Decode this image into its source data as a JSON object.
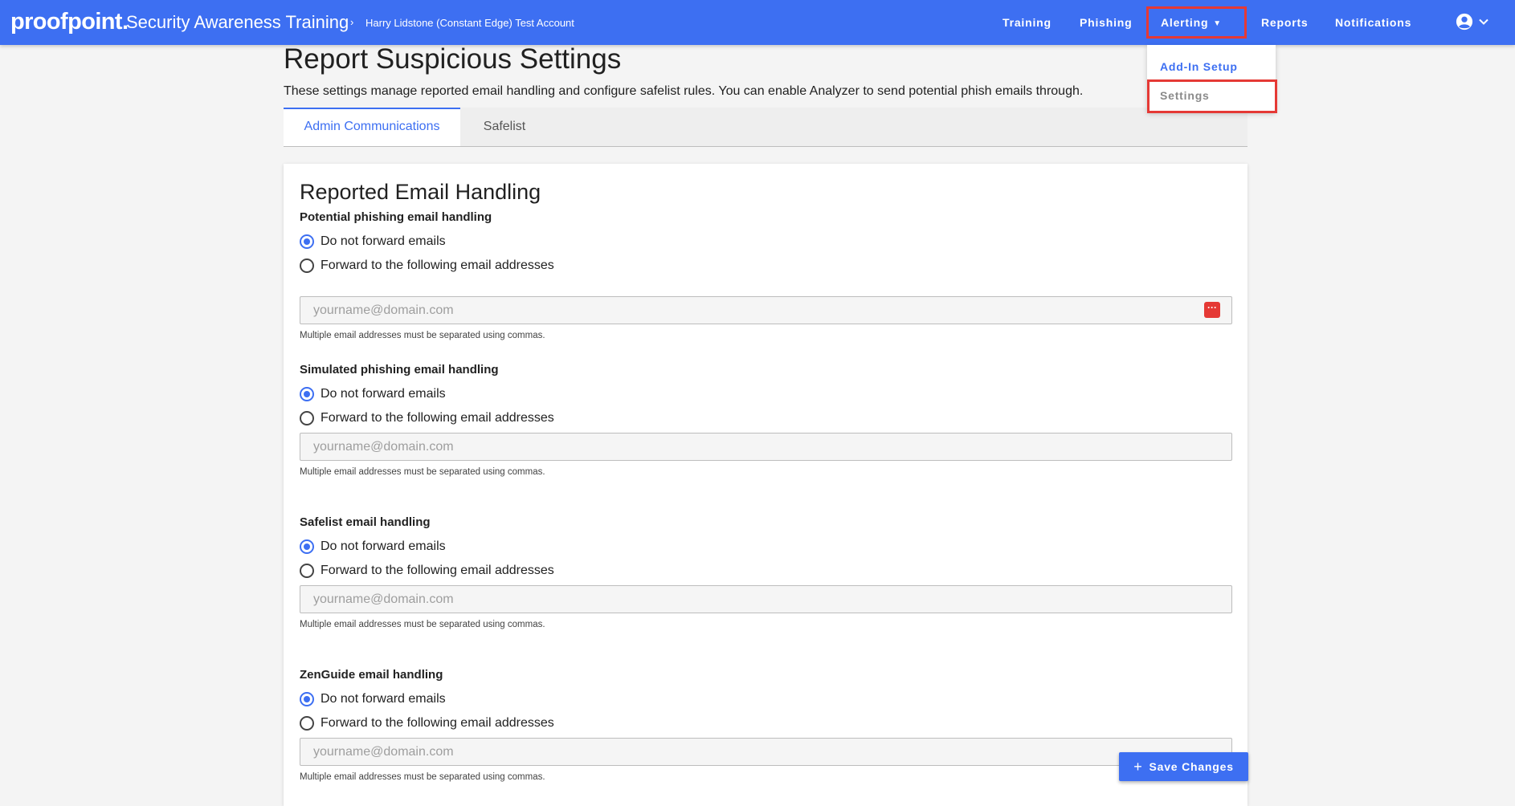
{
  "header": {
    "logo": "proofpoint.",
    "app_name": "Security Awareness Training",
    "breadcrumb_separator": "›",
    "account": "Harry Lidstone (Constant Edge) Test Account",
    "nav": {
      "training": "Training",
      "phishing": "Phishing",
      "alerting": "Alerting",
      "reports": "Reports",
      "notifications": "Notifications"
    }
  },
  "alerting_menu": {
    "add_in_setup": "Add-In Setup",
    "settings": "Settings"
  },
  "page": {
    "title": "Report Suspicious Settings",
    "description": "These settings manage reported email handling and configure safelist rules. You can enable Analyzer to send potential phish emails through."
  },
  "tabs": {
    "admin": "Admin Communications",
    "safelist": "Safelist"
  },
  "card": {
    "title": "Reported Email Handling",
    "sections": [
      {
        "label": "Potential phishing email handling",
        "option_no_forward": "Do not forward emails",
        "option_forward": "Forward to the following email addresses",
        "selected": "Do not forward emails",
        "placeholder": "yourname@domain.com",
        "hint": "Multiple email addresses must be separated using commas."
      },
      {
        "label": "Simulated phishing email handling",
        "option_no_forward": "Do not forward emails",
        "option_forward": "Forward to the following email addresses",
        "selected": "Do not forward emails",
        "placeholder": "yourname@domain.com",
        "hint": "Multiple email addresses must be separated using commas."
      },
      {
        "label": "Safelist email handling",
        "option_no_forward": "Do not forward emails",
        "option_forward": "Forward to the following email addresses",
        "selected": "Do not forward emails",
        "placeholder": "yourname@domain.com",
        "hint": "Multiple email addresses must be separated using commas."
      },
      {
        "label": "ZenGuide email handling",
        "option_no_forward": "Do not forward emails",
        "option_forward": "Forward to the following email addresses",
        "selected": "Do not forward emails",
        "placeholder": "yourname@domain.com",
        "hint": "Multiple email addresses must be separated using commas."
      }
    ]
  },
  "save_button": {
    "icon": "plus-icon",
    "label": "Save Changes"
  },
  "colors": {
    "brand_blue": "#3d6ff2",
    "highlight_red": "#e53935"
  }
}
